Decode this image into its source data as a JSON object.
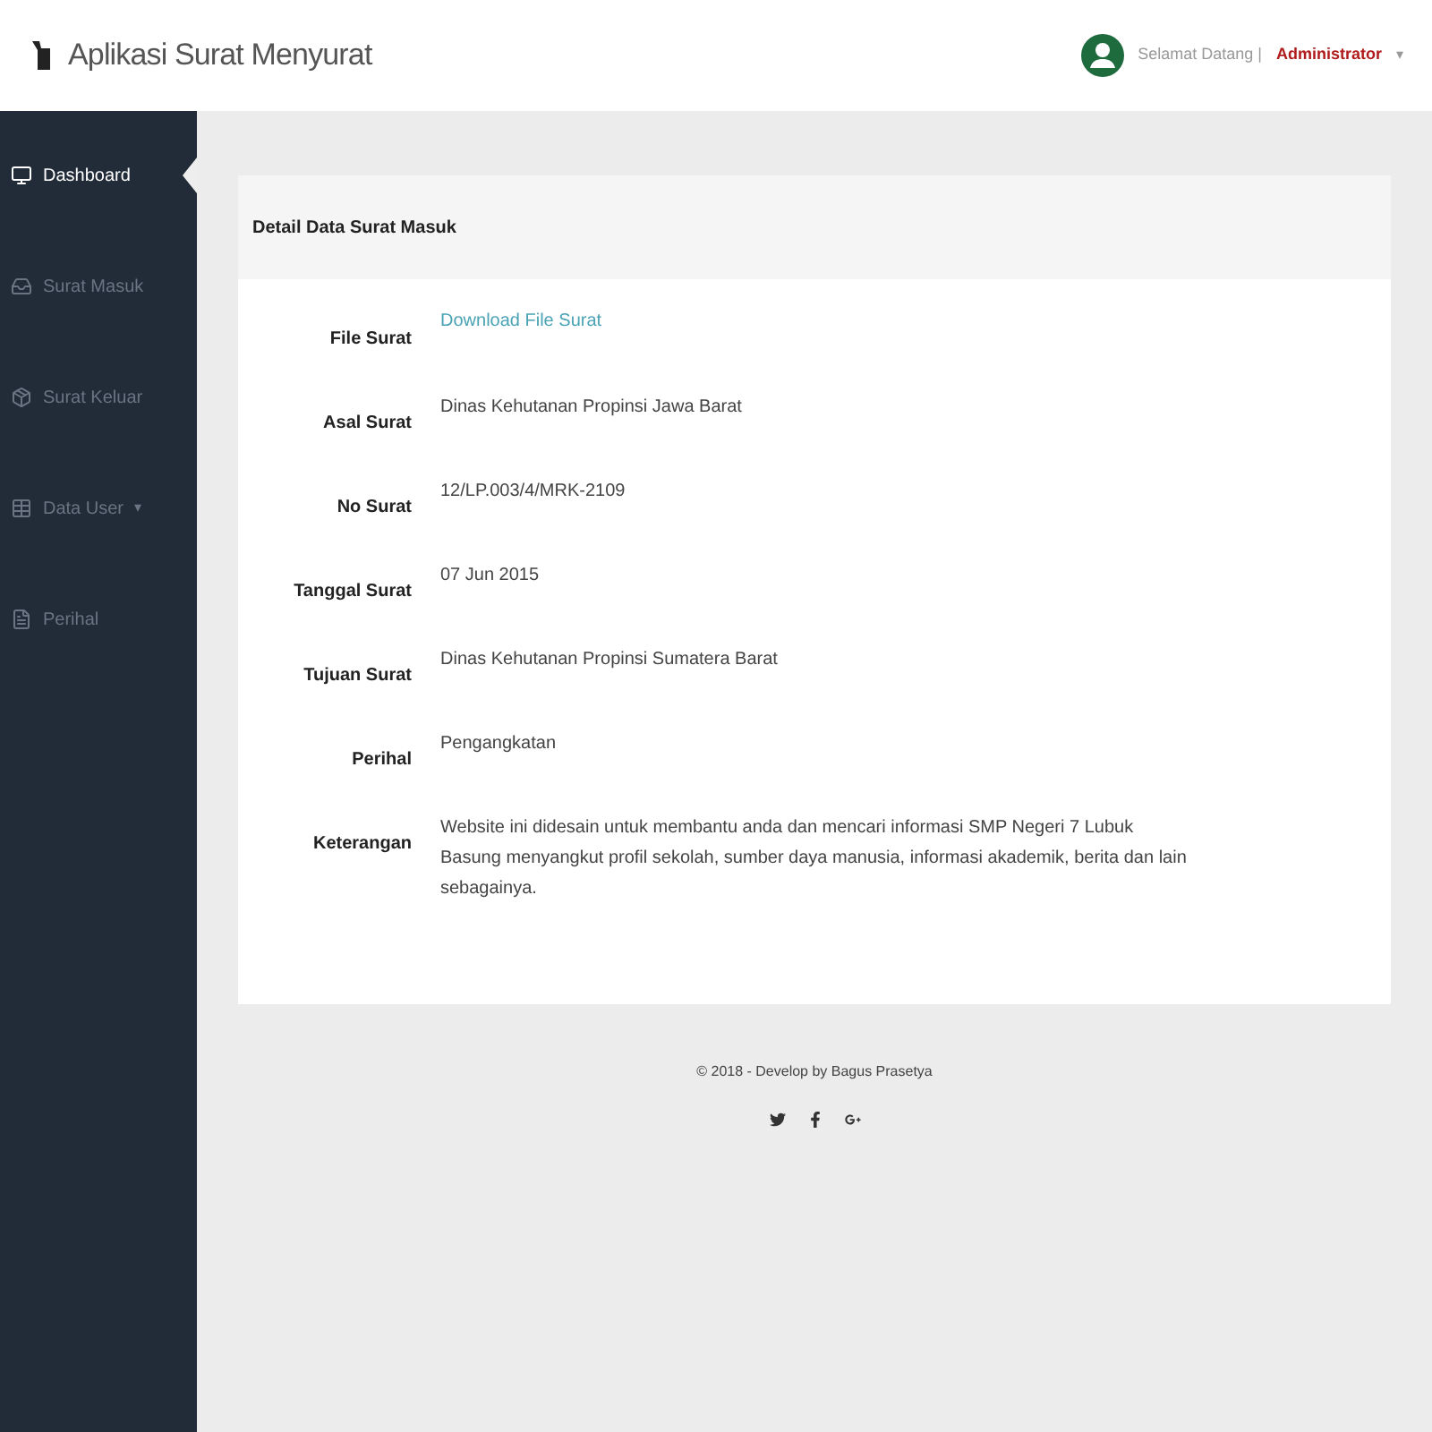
{
  "header": {
    "title": "Aplikasi Surat Menyurat",
    "greeting": "Selamat Datang |",
    "user": "Administrator",
    "caret": "▾"
  },
  "sidebar": {
    "items": [
      {
        "label": "Dashboard",
        "selected": true
      },
      {
        "label": "Surat Masuk",
        "selected": false
      },
      {
        "label": "Surat Keluar",
        "selected": false
      },
      {
        "label": "Data User",
        "selected": false,
        "caret": "▾"
      },
      {
        "label": "Perihal",
        "selected": false
      }
    ]
  },
  "panel": {
    "title": "Detail Data Surat Masuk",
    "fields": [
      {
        "label": "File Surat",
        "value": "Download File Surat",
        "kind": "link"
      },
      {
        "label": "Asal Surat",
        "value": "Dinas Kehutanan Propinsi Jawa Barat",
        "kind": "text"
      },
      {
        "label": "No Surat",
        "value": "12/LP.003/4/MRK-2109",
        "kind": "text"
      },
      {
        "label": "Tanggal Surat",
        "value": "07 Jun 2015",
        "kind": "text"
      },
      {
        "label": "Tujuan Surat",
        "value": "Dinas Kehutanan Propinsi Sumatera Barat",
        "kind": "text"
      },
      {
        "label": "Perihal",
        "value": "Pengangkatan",
        "kind": "text"
      },
      {
        "label": "Keterangan",
        "value": "Website ini didesain untuk membantu anda dan mencari informasi SMP Negeri 7 Lubuk Basung menyangkut profil sekolah, sumber daya manusia, informasi akademik, berita dan lain sebagainya.",
        "kind": "text"
      }
    ]
  },
  "footer": {
    "text": "© 2018 - Develop by Bagus Prasetya"
  }
}
